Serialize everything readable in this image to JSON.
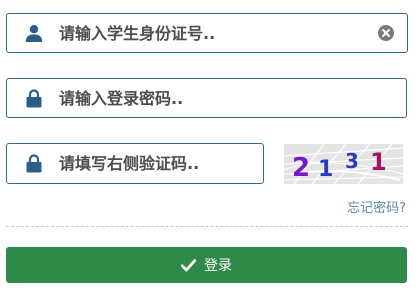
{
  "login_form": {
    "student_id": {
      "icon": "user-icon",
      "value": "",
      "placeholder": "请输入学生身份证号.."
    },
    "password": {
      "icon": "lock-icon",
      "value": "",
      "placeholder": "请输入登录密码.."
    },
    "captcha": {
      "icon": "lock-icon",
      "value": "",
      "placeholder": "请填写右侧验证码..",
      "image_text": "2131"
    },
    "forgot_password_label": "忘记密码?",
    "login_button": {
      "icon": "check-icon",
      "label": "登录"
    }
  },
  "colors": {
    "field_border": "#2e6a98",
    "icon": "#2b5d86",
    "button_bg": "#2f8a4a",
    "link": "#5b87a8"
  }
}
